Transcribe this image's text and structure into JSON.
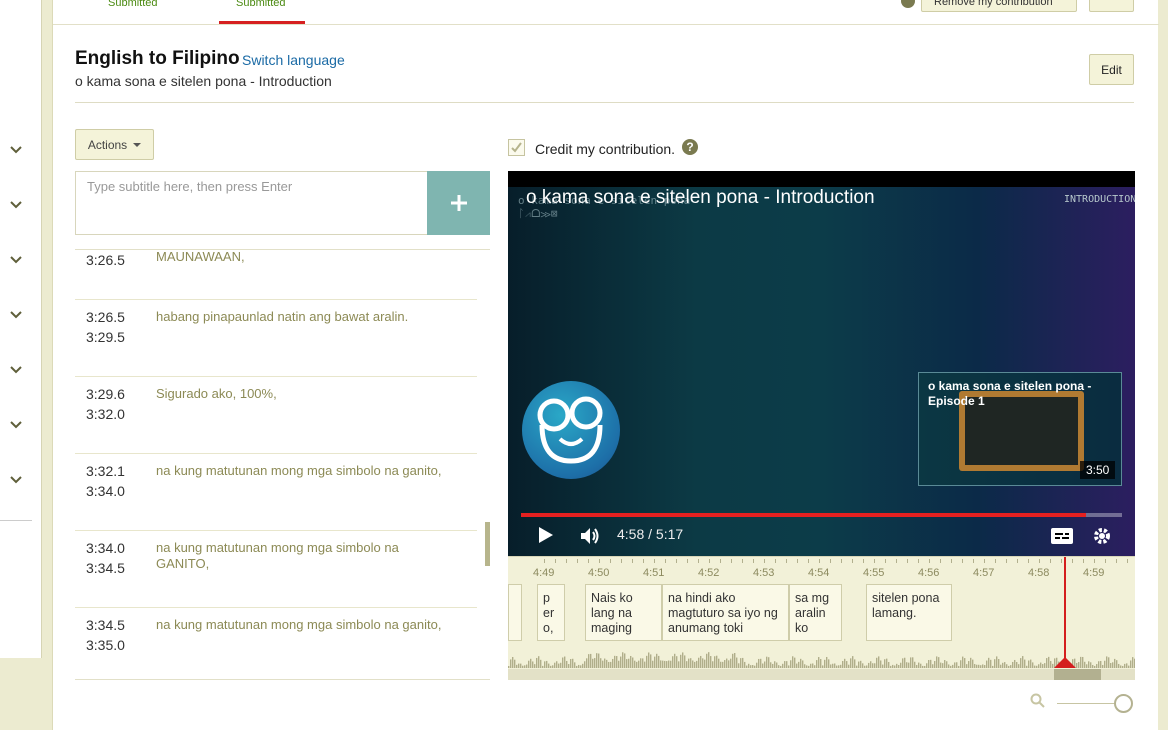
{
  "tabs": [
    {
      "label": "Submitted"
    },
    {
      "label": "Submitted"
    }
  ],
  "top_buttons": {
    "remove_contribution": "Remove my contribution"
  },
  "header": {
    "title": "English to Filipino",
    "switch_language": "Switch language",
    "video_name": "o kama sona e sitelen pona - Introduction",
    "edit_label": "Edit"
  },
  "actions_label": "Actions",
  "subtitle_input": {
    "placeholder": "Type subtitle here, then press Enter",
    "add_icon": "plus-icon"
  },
  "subtitles": [
    {
      "start": "3:26.5",
      "end": "",
      "text": "MAUNAWAAN,"
    },
    {
      "start": "3:26.5",
      "end": "3:29.5",
      "text": "habang pinapaunlad natin ang bawat aralin."
    },
    {
      "start": "3:29.6",
      "end": "3:32.0",
      "text": "Sigurado ako, 100%,"
    },
    {
      "start": "3:32.1",
      "end": "3:34.0",
      "text": "na kung matutunan mong mga simbolo na ganito,"
    },
    {
      "start": "3:34.0",
      "end": "3:34.5",
      "text": "na kung matutunan mong mga simbolo na GANITO,"
    },
    {
      "start": "3:34.5",
      "end": "3:35.0",
      "text": "na kung matutunan mong mga simbolo na ganito,"
    }
  ],
  "credit": {
    "label": "Credit my contribution.",
    "help": "?",
    "checked": true
  },
  "video": {
    "title": "o kama sona e sitelen pona - Introduction",
    "overlay_right": "INTRODUCTION",
    "endcard_title": "o kama sona e sitelen pona - Episode 1",
    "endcard_duration": "3:50",
    "current_time": "4:58",
    "total_time": "5:17",
    "time_display": "4:58 / 5:17",
    "progress": 0.94,
    "icons": [
      "play-icon",
      "volume-icon",
      "captions-icon",
      "settings-icon"
    ]
  },
  "timeline": {
    "ticks": [
      "4:49",
      "4:50",
      "4:51",
      "4:52",
      "4:53",
      "4:54",
      "4:55",
      "4:56",
      "4:57",
      "4:58",
      "4:59"
    ],
    "cues": [
      {
        "text": "p er o,"
      },
      {
        "text": "Nais ko lang na maging"
      },
      {
        "text": "na hindi ako magtuturo sa iyo ng anumang toki"
      },
      {
        "text": "sa mg aralin ko"
      },
      {
        "text": "sitelen pona lamang."
      }
    ]
  },
  "colors": {
    "accent_red": "#d41e1e",
    "add_button": "#7fb5b0",
    "tab_text": "#4b8a12",
    "link": "#1a6aa5"
  }
}
